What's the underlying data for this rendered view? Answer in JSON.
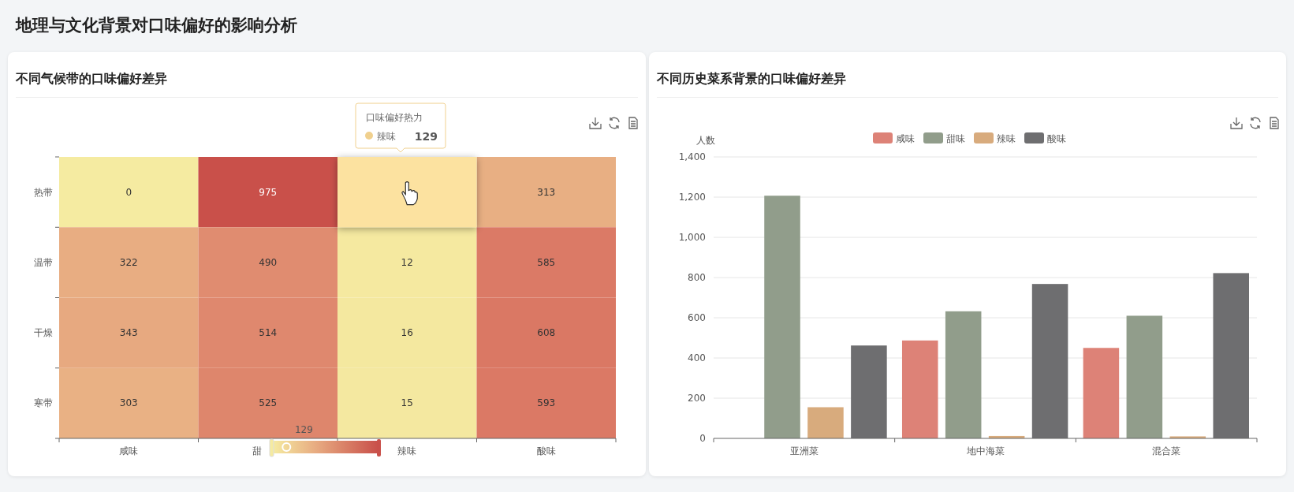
{
  "page_title": "地理与文化背景对口味偏好的影响分析",
  "panels": [
    {
      "title": "不同气候带的口味偏好差异",
      "heatmap": {
        "x_categories": [
          "咸味",
          "甜",
          "辣味",
          "酸味"
        ],
        "rows": [
          {
            "label": "热带",
            "cells": [
              {
                "value": "0",
                "highlighted": false
              },
              {
                "value": "975",
                "highlighted": false
              },
              {
                "highlighted": true
              },
              {
                "value": "313",
                "highlighted": false
              }
            ]
          },
          {
            "label": "温带",
            "cells": [
              {
                "value": "322",
                "highlighted": false
              },
              {
                "value": "490",
                "highlighted": false
              },
              {
                "value": "12",
                "highlighted": false
              },
              {
                "value": "585",
                "highlighted": false
              }
            ]
          },
          {
            "label": "干燥",
            "cells": [
              {
                "value": "343",
                "highlighted": false
              },
              {
                "value": "514",
                "highlighted": false
              },
              {
                "value": "16",
                "highlighted": false
              },
              {
                "value": "608",
                "highlighted": false
              }
            ]
          },
          {
            "label": "寒带",
            "cells": [
              {
                "value": "303",
                "highlighted": false
              },
              {
                "value": "525",
                "highlighted": false
              },
              {
                "value": "15",
                "highlighted": false
              },
              {
                "value": "593",
                "highlighted": false
              }
            ]
          }
        ],
        "visual_map": {
          "indicator_label": "129",
          "level": 0.13
        },
        "tooltip": {
          "title": "口味偏好热力",
          "name": "辣味",
          "value": "129",
          "color": "#f0d08e"
        }
      }
    },
    {
      "title": "不同历史菜系背景的口味偏好差异",
      "chart_data": {
        "type": "bar",
        "grid": true,
        "legend": true,
        "ylabel": "人数",
        "categories": [
          "亚洲菜",
          "地中海菜",
          "混合菜"
        ],
        "ylim": [
          0,
          1400
        ],
        "yticks": [
          {
            "value": 0,
            "label": "0"
          },
          {
            "value": 200,
            "label": "200"
          },
          {
            "value": 400,
            "label": "400"
          },
          {
            "value": 600,
            "label": "600"
          },
          {
            "value": 800,
            "label": "800"
          },
          {
            "value": 1000,
            "label": "1,000"
          },
          {
            "value": 1200,
            "label": "1,200"
          },
          {
            "value": 1400,
            "label": "1,400"
          }
        ],
        "series": [
          {
            "name": "咸味",
            "color": "#dd8277",
            "values": [
              0,
              487,
              450
            ]
          },
          {
            "name": "甜味",
            "color": "#919d8b",
            "values": [
              1207,
              632,
              610
            ]
          },
          {
            "name": "辣味",
            "color": "#d8ab7d",
            "values": [
              155,
              12,
              10
            ]
          },
          {
            "name": "酸味",
            "color": "#6e6e70",
            "values": [
              462,
              768,
              822
            ]
          }
        ]
      }
    }
  ]
}
